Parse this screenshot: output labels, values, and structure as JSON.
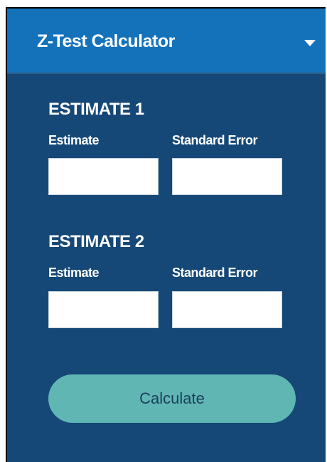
{
  "header": {
    "title": "Z-Test Calculator",
    "toggle_icon": "caret-down-icon"
  },
  "estimate1": {
    "title": "ESTIMATE 1",
    "estimate_label": "Estimate",
    "estimate_value": "",
    "se_label": "Standard Error",
    "se_value": ""
  },
  "estimate2": {
    "title": "ESTIMATE 2",
    "estimate_label": "Estimate",
    "estimate_value": "",
    "se_label": "Standard Error",
    "se_value": ""
  },
  "actions": {
    "calculate_label": "Calculate"
  },
  "colors": {
    "panel_background": "#154877",
    "header_background": "#1472bb",
    "button_background": "#60b6b3",
    "text": "#ffffff"
  }
}
